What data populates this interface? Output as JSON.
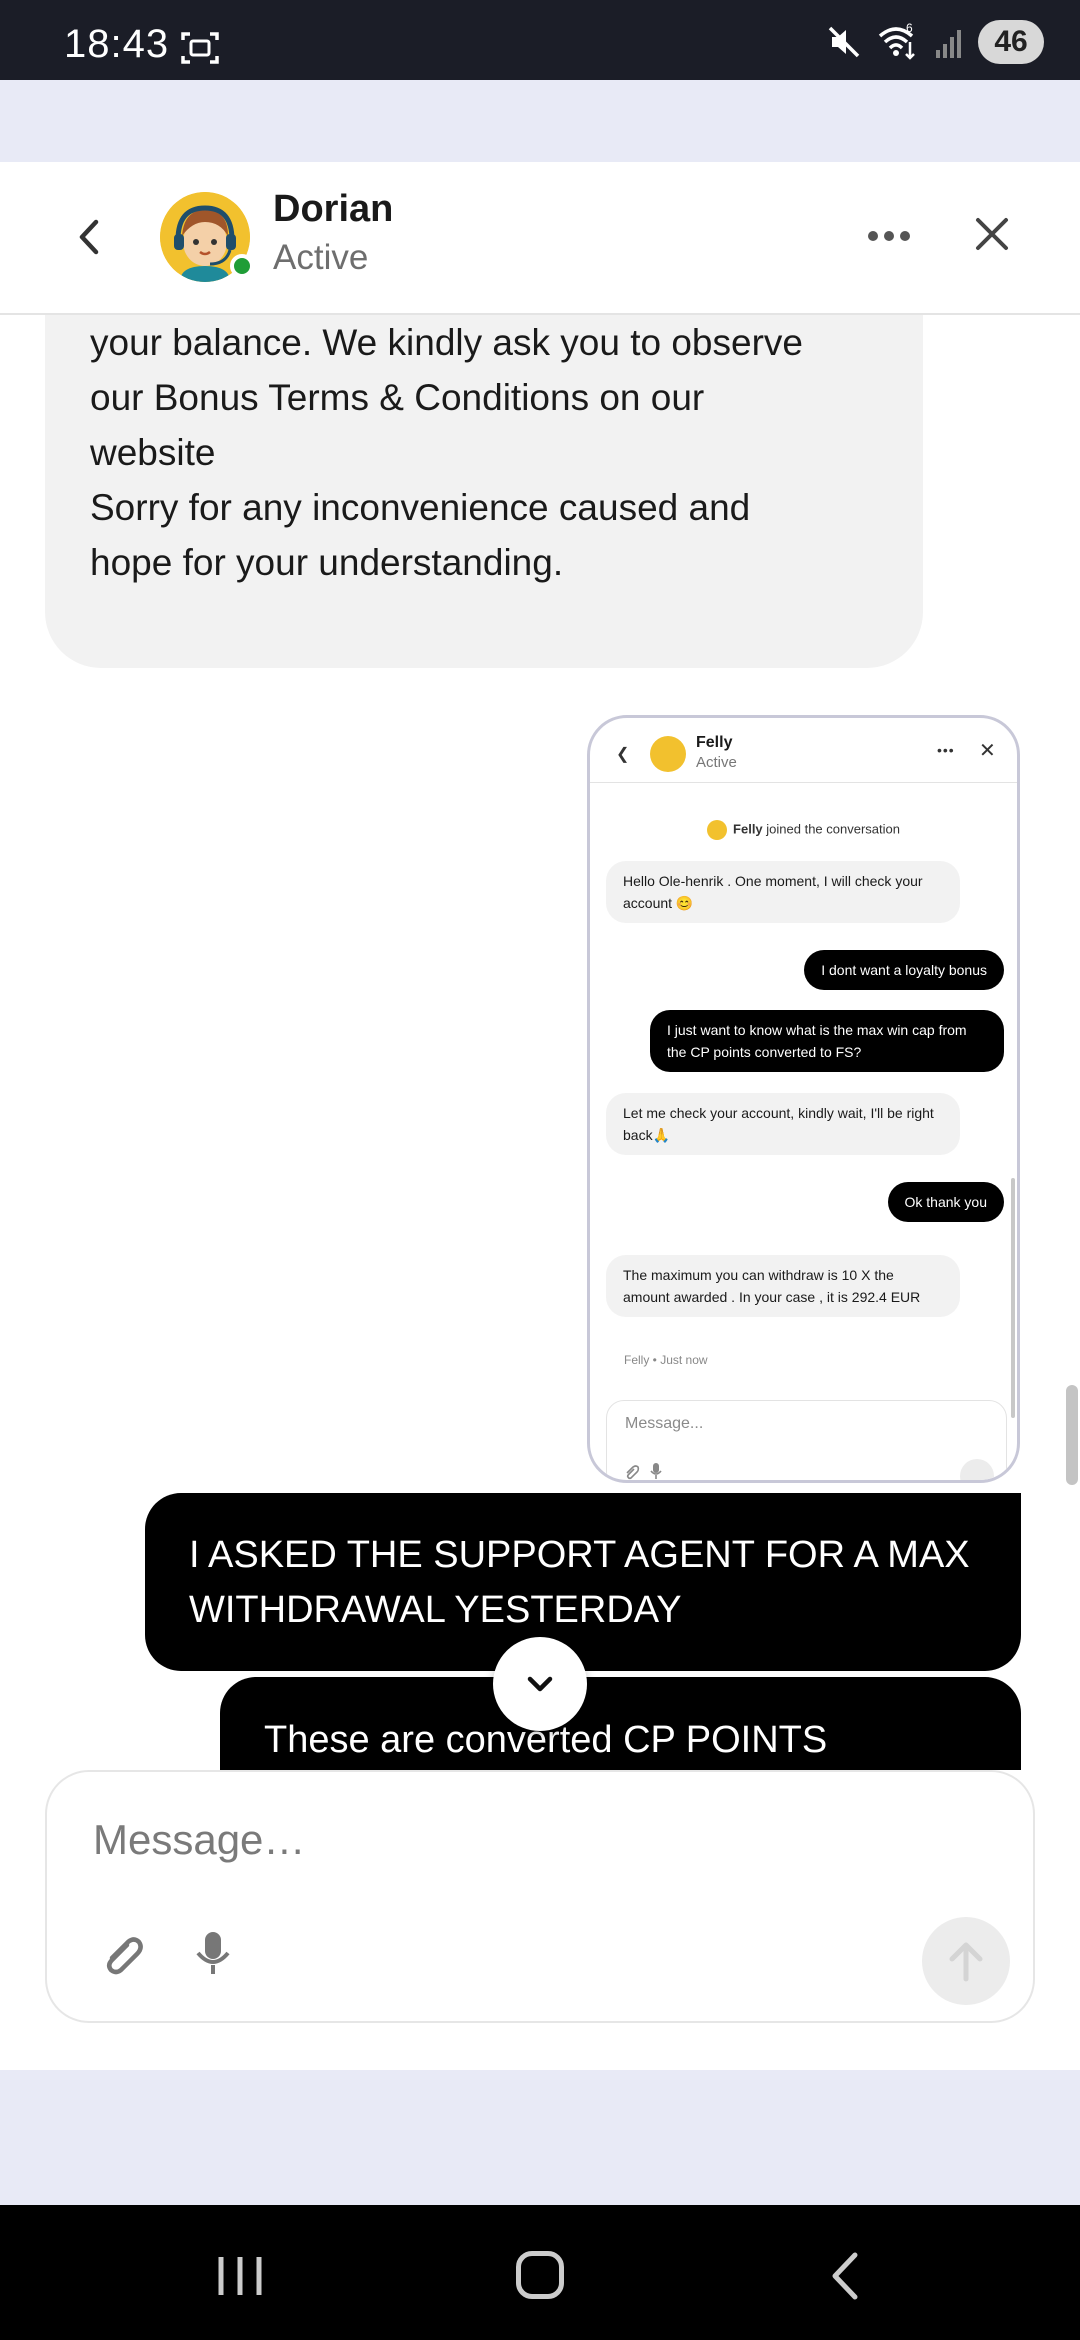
{
  "status_bar": {
    "time": "18:43",
    "battery": "46",
    "icons": [
      "screenshot-icon",
      "mute-icon",
      "wifi-icon",
      "signal-icon",
      "battery-icon"
    ]
  },
  "header": {
    "agent_name": "Dorian",
    "agent_status": "Active",
    "online_color": "#1f9d37"
  },
  "messages": {
    "agent_text_lines": [
      "your balance. We kindly ask you to observe",
      "our Bonus Terms & Conditions on our",
      "website",
      "Sorry for any inconvenience caused and",
      "hope for your understanding."
    ],
    "user_1": "I ASKED THE SUPPORT AGENT FOR A MAX WITHDRAWAL YESTERDAY",
    "user_2": "These are converted CP POINTS BONUS!"
  },
  "embedded_screenshot": {
    "agent_name": "Felly",
    "agent_status": "Active",
    "joined_name": "Felly",
    "joined_text": " joined the conversation",
    "m1": "Hello Ole-henrik . One moment, I will check your account 😊",
    "m2": "I dont want a loyalty bonus",
    "m3": "I just want to know what is the max win cap from the CP points converted to FS?",
    "m4": "Let me check your account, kindly wait, I'll be right back🙏",
    "m5": "Ok thank you",
    "m6": "The maximum you can withdraw is 10 X the amount awarded . In your case , it is 292.4 EUR",
    "meta": "Felly • Just now",
    "input_placeholder": "Message..."
  },
  "composer": {
    "placeholder": "Message…"
  },
  "colors": {
    "accent_bg": "#e8eaf6",
    "user_bubble": "#000000",
    "agent_bubble": "#f2f2f2",
    "avatar_bg": "#f2c12e"
  }
}
